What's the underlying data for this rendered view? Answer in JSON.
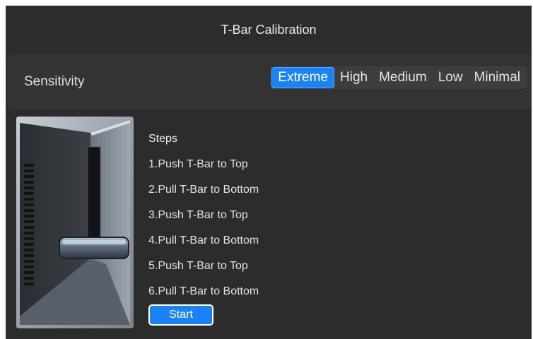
{
  "window": {
    "title": "T-Bar Calibration"
  },
  "sensitivity": {
    "label": "Sensitivity",
    "options": [
      "Extreme",
      "High",
      "Medium",
      "Low",
      "Minimal"
    ],
    "selected": "Extreme"
  },
  "steps": {
    "title": "Steps",
    "items": [
      "1.Push T-Bar to Top",
      "2.Pull T-Bar to Bottom",
      "3.Push T-Bar to Top",
      "4.Pull T-Bar to Bottom",
      "5.Push T-Bar to Top",
      "6.Pull T-Bar to Bottom"
    ]
  },
  "start_button": {
    "label": "Start"
  },
  "colors": {
    "accent": "#1a82f7",
    "background": "#2c2c2c",
    "panel": "#333333"
  },
  "icons": {
    "device": "t-bar-device-icon"
  }
}
